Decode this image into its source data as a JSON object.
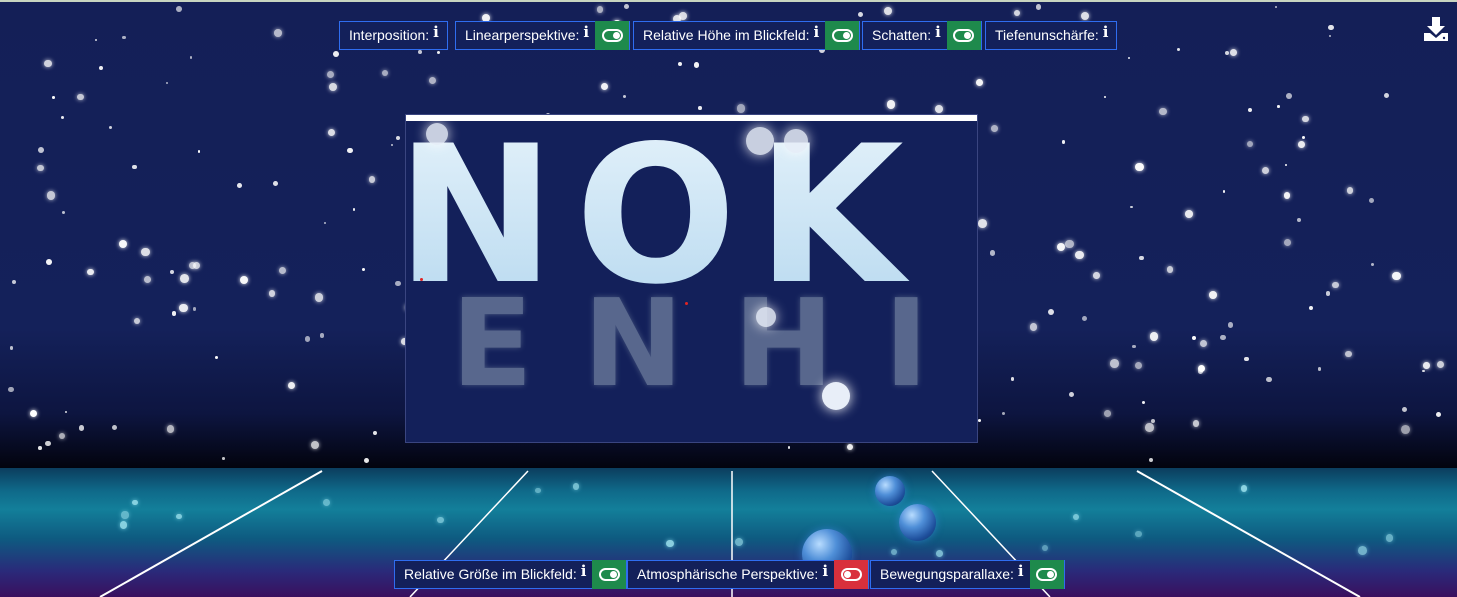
{
  "top_controls": [
    {
      "label": "Interposition:",
      "info": "i",
      "has_toggle": false
    },
    {
      "label": "Linearperspektive:",
      "info": "i",
      "has_toggle": true,
      "state": "on"
    },
    {
      "label": "Relative Höhe im Blickfeld:",
      "info": "i",
      "has_toggle": true,
      "state": "on"
    },
    {
      "label": "Schatten:",
      "info": "i",
      "has_toggle": true,
      "state": "on"
    },
    {
      "label": "Tiefenunschärfe:",
      "info": "i",
      "has_toggle": false
    }
  ],
  "bottom_controls": [
    {
      "label": "Relative Größe im Blickfeld:",
      "info": "i",
      "has_toggle": true,
      "state": "on"
    },
    {
      "label": "Atmosphärische Perspektive:",
      "info": "i",
      "has_toggle": true,
      "state": "off"
    },
    {
      "label": "Bewegungsparallaxe:",
      "info": "i",
      "has_toggle": true,
      "state": "on"
    }
  ],
  "scene": {
    "big_text": "NOK",
    "mid_text": "ENHI"
  },
  "icons": {
    "download": "download-icon",
    "info": "info-icon",
    "toggle": "toggle-switch-icon"
  },
  "colors": {
    "toggle_on": "#1e8a4c",
    "toggle_off": "#d9303c",
    "control_border": "#2f6df0",
    "sky": "#14215a"
  }
}
